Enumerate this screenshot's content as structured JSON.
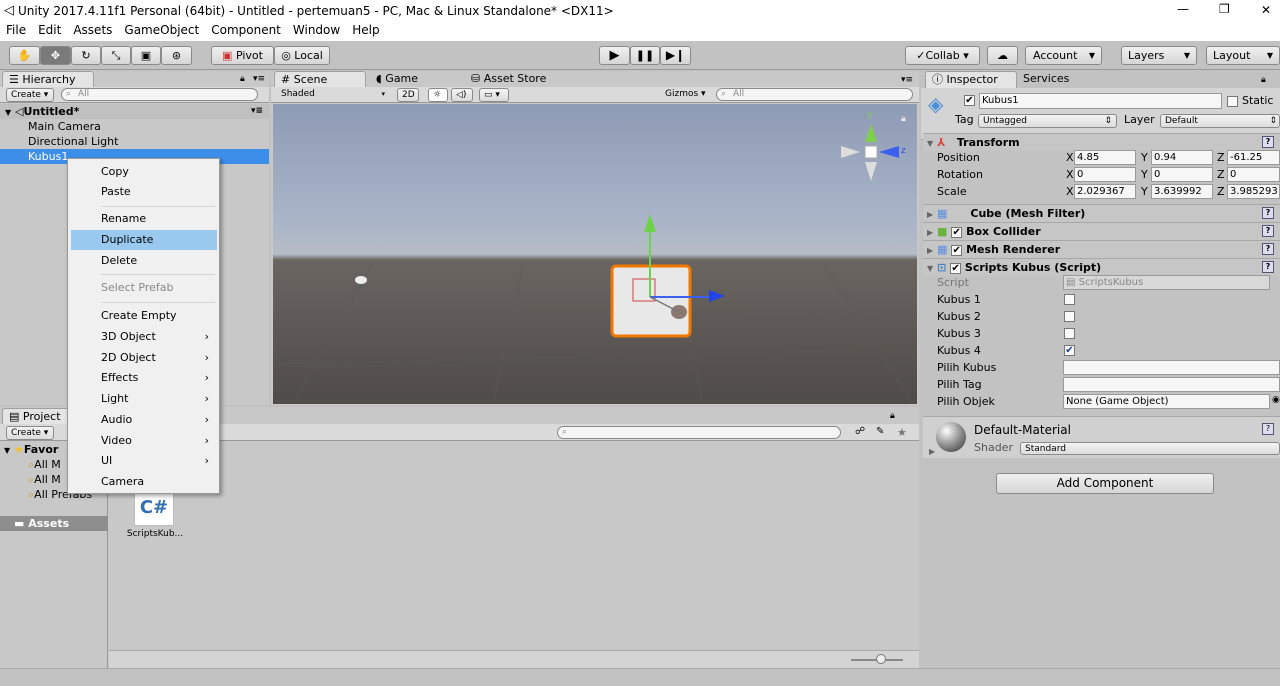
{
  "window": {
    "title": "Unity 2017.4.11f1 Personal (64bit) - Untitled - pertemuan5 - PC, Mac & Linux Standalone* <DX11>",
    "minimize": "—",
    "maximize": "❐",
    "close": "✕"
  },
  "menu": [
    "File",
    "Edit",
    "Assets",
    "GameObject",
    "Component",
    "Window",
    "Help"
  ],
  "toolbar": {
    "pivot": "Pivot",
    "local": "Local",
    "collab": "Collab ▾",
    "account": "Account",
    "layers": "Layers",
    "layout": "Layout"
  },
  "hierarchy": {
    "tab": "Hierarchy",
    "create": "Create",
    "search": "All",
    "scene": "Untitled*",
    "items": [
      "Main Camera",
      "Directional Light",
      "Kubus1"
    ]
  },
  "context_menu": {
    "items": [
      {
        "label": "Copy"
      },
      {
        "label": "Paste"
      },
      {
        "label": "Rename"
      },
      {
        "label": "Duplicate"
      },
      {
        "label": "Delete"
      },
      {
        "label": "Select Prefab"
      },
      {
        "label": "Create Empty"
      },
      {
        "label": "3D Object"
      },
      {
        "label": "2D Object"
      },
      {
        "label": "Effects"
      },
      {
        "label": "Light"
      },
      {
        "label": "Audio"
      },
      {
        "label": "Video"
      },
      {
        "label": "UI"
      },
      {
        "label": "Camera"
      }
    ],
    "submenu_arrow": "›"
  },
  "scene": {
    "tabs": [
      "Scene",
      "Game",
      "Asset Store"
    ],
    "shading": "Shaded",
    "mode2d": "2D",
    "gizmos": "Gizmos",
    "search": "All",
    "axis_y": "y",
    "axis_z": "z"
  },
  "project": {
    "tab": "Project",
    "create": "Create",
    "favorites": "Favor",
    "fav_items": [
      "All M",
      "All M",
      "All Prefabs"
    ],
    "assets": "Assets",
    "asset_name": "ScriptsKub...",
    "asset_glyph": "C#"
  },
  "inspector": {
    "tabs": [
      "Inspector",
      "Services"
    ],
    "object_name": "Kubus1",
    "static": "Static",
    "tag_label": "Tag",
    "tag_value": "Untagged",
    "layer_label": "Layer",
    "layer_value": "Default",
    "transform": {
      "title": "Transform",
      "rows": [
        {
          "label": "Position",
          "x": "4.85",
          "y": "0.94",
          "z": "-61.25"
        },
        {
          "label": "Rotation",
          "x": "0",
          "y": "0",
          "z": "0"
        },
        {
          "label": "Scale",
          "x": "2.029367",
          "y": "3.639992",
          "z": "3.985293"
        }
      ],
      "x": "X",
      "y": "Y",
      "z": "Z"
    },
    "components": [
      "Cube (Mesh Filter)",
      "Box Collider",
      "Mesh Renderer",
      "Scripts Kubus (Script)"
    ],
    "script": {
      "script_label": "Script",
      "script_value": "ScriptsKubus",
      "bools": [
        {
          "label": "Kubus 1",
          "checked": false
        },
        {
          "label": "Kubus 2",
          "checked": false
        },
        {
          "label": "Kubus 3",
          "checked": false
        },
        {
          "label": "Kubus 4",
          "checked": true
        }
      ],
      "pilih_kubus": "Pilih Kubus",
      "pilih_tag": "Pilih Tag",
      "pilih_objek": "Pilih Objek",
      "pilih_objek_value": "None (Game Object)"
    },
    "material": {
      "name": "Default-Material",
      "shader_label": "Shader",
      "shader_value": "Standard"
    },
    "add_component": "Add Component"
  },
  "colors": {
    "selection": "#3d8ee8",
    "menu_highlight": "#99c9ef",
    "cube_outline": "#f07800"
  }
}
